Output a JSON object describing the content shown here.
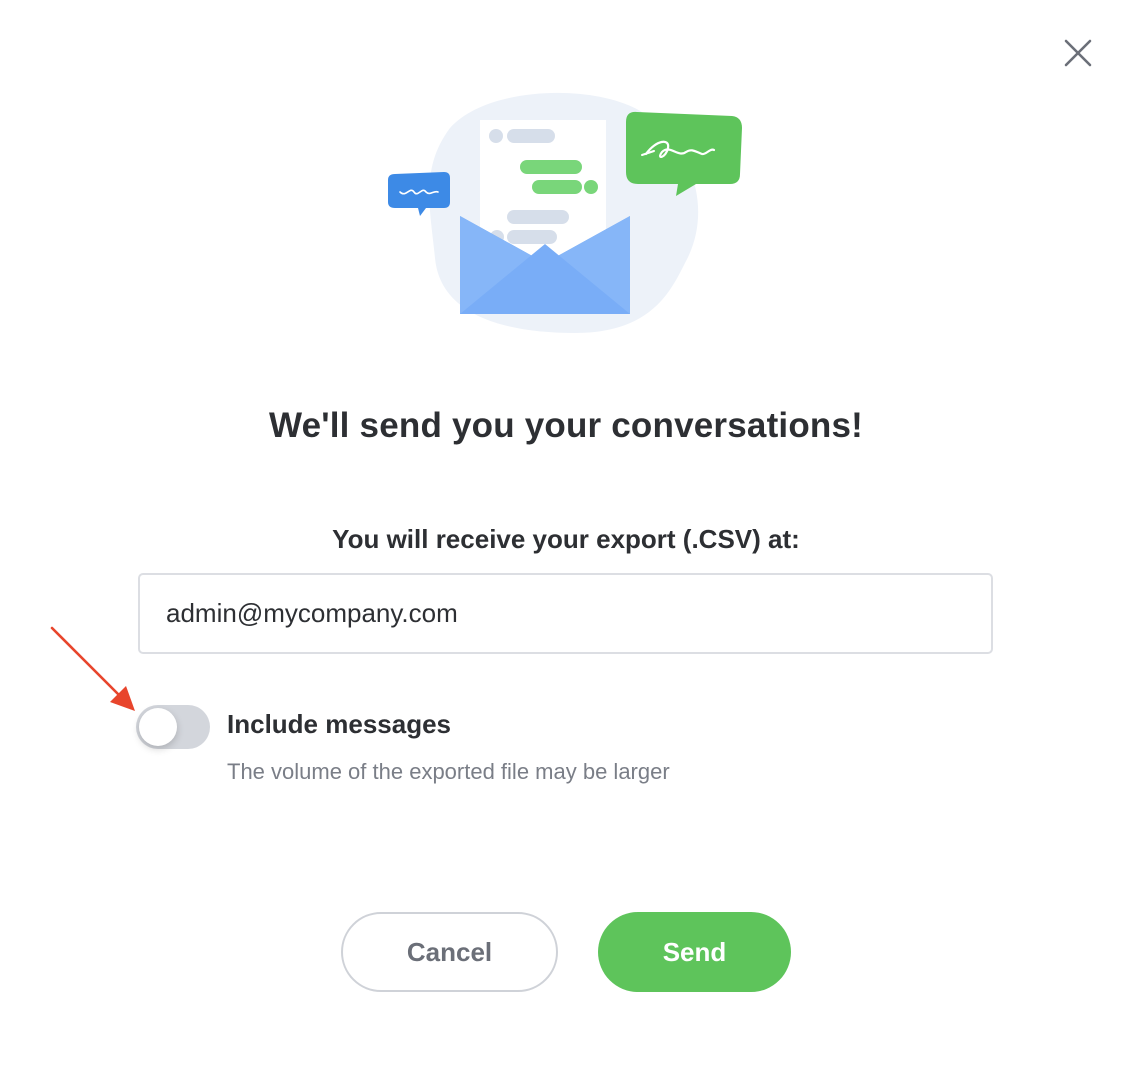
{
  "dialog": {
    "close_icon": "close-icon",
    "illustration": "envelope-with-chat-bubbles-illustration",
    "title": "We'll send you your conversations!",
    "subtitle": "You will receive your export (.CSV) at:",
    "email": {
      "value": "admin@mycompany.com",
      "placeholder": ""
    },
    "include_messages": {
      "label": "Include messages",
      "hint": "The volume of the exported file may be larger",
      "enabled": false
    },
    "buttons": {
      "cancel_label": "Cancel",
      "send_label": "Send"
    }
  },
  "colors": {
    "send_green": "#5ec45b",
    "toggle_off": "#d3d6dc",
    "annotation_arrow": "#e8452c",
    "envelope_blue": "#6ea6f5",
    "bubble_green": "#5ec45b",
    "bubble_blue": "#3d8ae6"
  }
}
